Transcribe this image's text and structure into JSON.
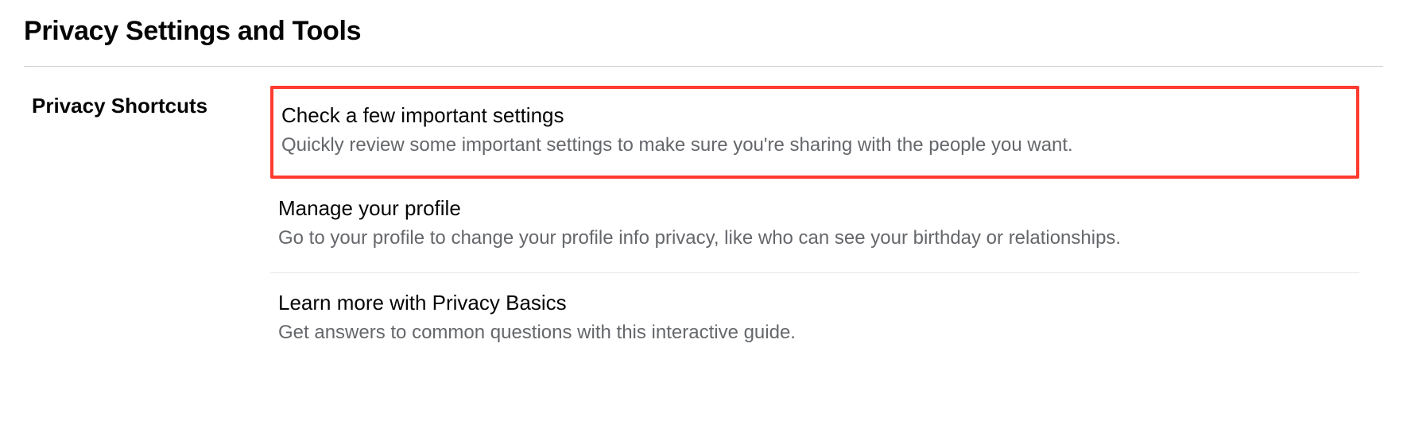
{
  "header": {
    "title": "Privacy Settings and Tools"
  },
  "sidebar": {
    "section_label": "Privacy Shortcuts"
  },
  "shortcuts": [
    {
      "title": "Check a few important settings",
      "description": "Quickly review some important settings to make sure you're sharing with the people you want.",
      "highlighted": true
    },
    {
      "title": "Manage your profile",
      "description": "Go to your profile to change your profile info privacy, like who can see your birthday or relationships.",
      "highlighted": false
    },
    {
      "title": "Learn more with Privacy Basics",
      "description": "Get answers to common questions with this interactive guide.",
      "highlighted": false
    }
  ]
}
